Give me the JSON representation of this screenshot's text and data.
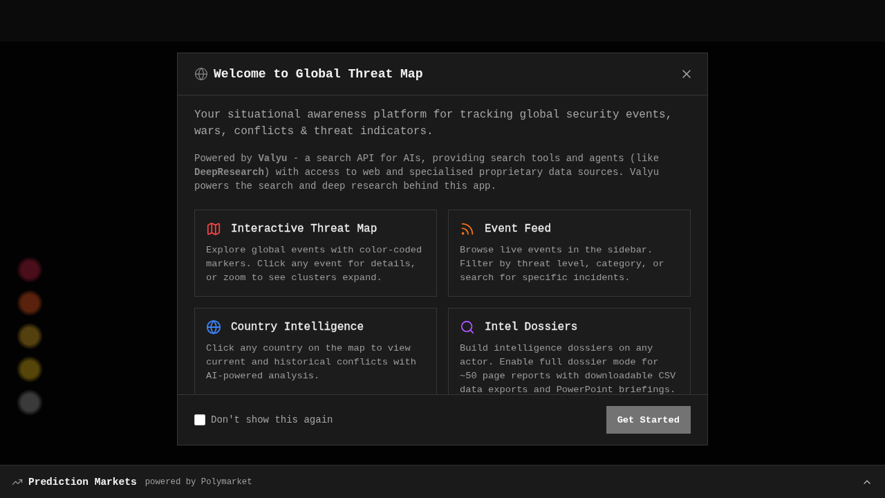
{
  "background": {
    "legend_markers": [
      {
        "color": "#4a0d1a"
      },
      {
        "color": "#5a220c"
      },
      {
        "color": "#54400e"
      },
      {
        "color": "#554508"
      },
      {
        "color": "#3a3a3a"
      }
    ]
  },
  "dialog": {
    "title": "Welcome to Global Threat Map",
    "lead": "Your situational awareness platform for tracking global security events, wars, conflicts & threat indicators.",
    "description": "Powered by **Valyu** - a search API for AIs, providing search tools and agents (like **DeepResearch**) with access to web and specialised proprietary data sources. Valyu powers the search and deep research behind this app.",
    "features": [
      {
        "kind": "map",
        "title": "Interactive Threat Map",
        "text": "Explore global events with color-coded markers. Click any event for details, or zoom to see clusters expand."
      },
      {
        "kind": "feed",
        "title": "Event Feed",
        "text": "Browse live events in the sidebar. Filter by threat level, category, or search for specific incidents."
      },
      {
        "kind": "globe",
        "title": "Country Intelligence",
        "text": "Click any country on the map to view current and historical conflicts with AI-powered analysis."
      },
      {
        "kind": "search",
        "title": "Intel Dossiers",
        "text": "Build intelligence dossiers on any actor. Enable full dossier mode for ~50 page reports with downloadable CSV data exports and PowerPoint briefings."
      }
    ],
    "dont_show_again": {
      "label": "Don't show this again",
      "checked": false
    },
    "primary_button": "Get Started"
  },
  "bottom_bar": {
    "title": "Prediction Markets",
    "subtitle": "powered by Polymarket",
    "expanded": false
  }
}
